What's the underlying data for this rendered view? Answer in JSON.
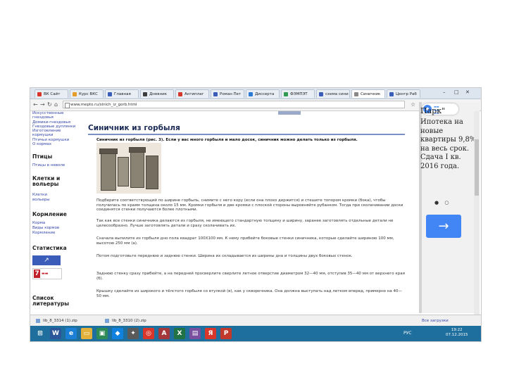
{
  "browser": {
    "tabs": [
      {
        "label": "ВК Сайт",
        "color": "#d9362b"
      },
      {
        "label": "Курс ВКС",
        "color": "#e49d2a"
      },
      {
        "label": "Главная",
        "color": "#3a5dba"
      },
      {
        "label": "Дневник",
        "color": "#3d3d3d"
      },
      {
        "label": "Антиплаг",
        "color": "#d4372c"
      },
      {
        "label": "Роман Пет",
        "color": "#3a5dba"
      },
      {
        "label": "Диссерта",
        "color": "#2b7ad6"
      },
      {
        "label": "ФЭМПЭТ",
        "color": "#2f9c4f"
      },
      {
        "label": "схема сини",
        "color": "#3a5dba"
      },
      {
        "label": "Синичник",
        "color": "#888888"
      },
      {
        "label": "Центр Раб",
        "color": "#3a5dba"
      }
    ],
    "url": "www.mepto.ru/sinich_iz_gorb.html",
    "controls": {
      "min": "–",
      "max": "□",
      "close": "✕"
    }
  },
  "sidebar": {
    "intro_lines": [
      "Искусственные",
      "гнездовья",
      "Домики-гнездовья",
      "Гнездовые дуплянки",
      "Изготовление",
      "кормушки",
      "Птичьи кормушки",
      "О кормах"
    ],
    "sections": [
      {
        "heading": "Птицы",
        "links": [
          "Птицы в неволе"
        ]
      },
      {
        "heading": "Клетки и вольеры",
        "links": [
          "Клетки",
          "вольеры"
        ]
      },
      {
        "heading": "Кормление",
        "links": [
          "Корма",
          "Виды кормов",
          "Кормление"
        ]
      },
      {
        "heading": "Статистика",
        "links": []
      },
      {
        "heading": "Список литературы",
        "links": []
      }
    ]
  },
  "article": {
    "title": "Синичник из горбыля",
    "intro": "Синичник из горбыля (рис. 3). Если у вас много горбыля и мало досок, синичник можно делать только из горбыля.",
    "paragraphs": [
      "Подберите соответствующий по ширине горбыль, снимите с него кору (если она плохо держится) и стешите топором кромки (бока), чтобы получилась по краям толщина около 15 мм. Кромки горбыля и две кромки с плоской стороны выровняйте рубанком. Тогда при сколачивании доски соединятся стенки получаются более плотными.",
      "Так как все стенки синичника делаются из горбыля, не имеющего стандартную толщину и ширину, заранее заготовлять отдельные детали не целесообразно. Лучше заготовлять детали и сразу сколачивать их.",
      "Сначала выпилите из горбыля дно пола квадрат 100Х100 мм. К нему прибейте боковые стенки синичника, которые сделайте шириною 100 мм, высотою 250 мм (а).",
      "Потом подготовьте переднюю и заднюю стенки. Ширина их складывается из ширины дна и толщины двух боковых стенок.",
      "Заднюю стенку сразу прибейте, а на передней просверлите сверлите летное отверстие диаметром 32—40 мм, отступив 35—40 мм от верхнего края (б).",
      "Крышку сделайте из широкого и тёлстого горбыля со втулкой (в), как у скворечника. Она должна выступать над летком вперед, примерно на 40—50 мм."
    ]
  },
  "ad": {
    "heading": "Парк\"",
    "body": "Ипотека на новые квартиры 9,8% на весь срок. Сдача I кв. 2016 года.",
    "dots": "● ○",
    "arrow": "→",
    "brand_color": "#4285f4"
  },
  "downloads": [
    {
      "label": "lib_8_3314 (1).zip"
    },
    {
      "label": "lib_8_3310 (2).zip"
    }
  ],
  "downloads_all": "Все загрузки",
  "taskbar": {
    "apps": [
      {
        "icon": "start-icon",
        "glyph": "⊞",
        "color": "#1f6f9e"
      },
      {
        "icon": "word-icon",
        "glyph": "W",
        "color": "#2b579a"
      },
      {
        "icon": "ie-icon",
        "glyph": "e",
        "color": "#1c7fd6"
      },
      {
        "icon": "folder-icon",
        "glyph": "▭",
        "color": "#e3b13b"
      },
      {
        "icon": "store-icon",
        "glyph": "▣",
        "color": "#2e8b57"
      },
      {
        "icon": "dropbox-icon",
        "glyph": "◆",
        "color": "#1081de"
      },
      {
        "icon": "photo-icon",
        "glyph": "✦",
        "color": "#5a5a5a"
      },
      {
        "icon": "chrome-icon",
        "glyph": "◎",
        "color": "#d9362b"
      },
      {
        "icon": "access-icon",
        "glyph": "A",
        "color": "#a4373a"
      },
      {
        "icon": "excel-icon",
        "glyph": "X",
        "color": "#217346"
      },
      {
        "icon": "archive-icon",
        "glyph": "▤",
        "color": "#7a4fa0"
      },
      {
        "icon": "yandex-icon",
        "glyph": "Я",
        "color": "#d9362b"
      },
      {
        "icon": "pdf-icon",
        "glyph": "P",
        "color": "#c0392b"
      }
    ],
    "lang": "РУС",
    "time": "19:22",
    "date": "07.12.2015"
  }
}
